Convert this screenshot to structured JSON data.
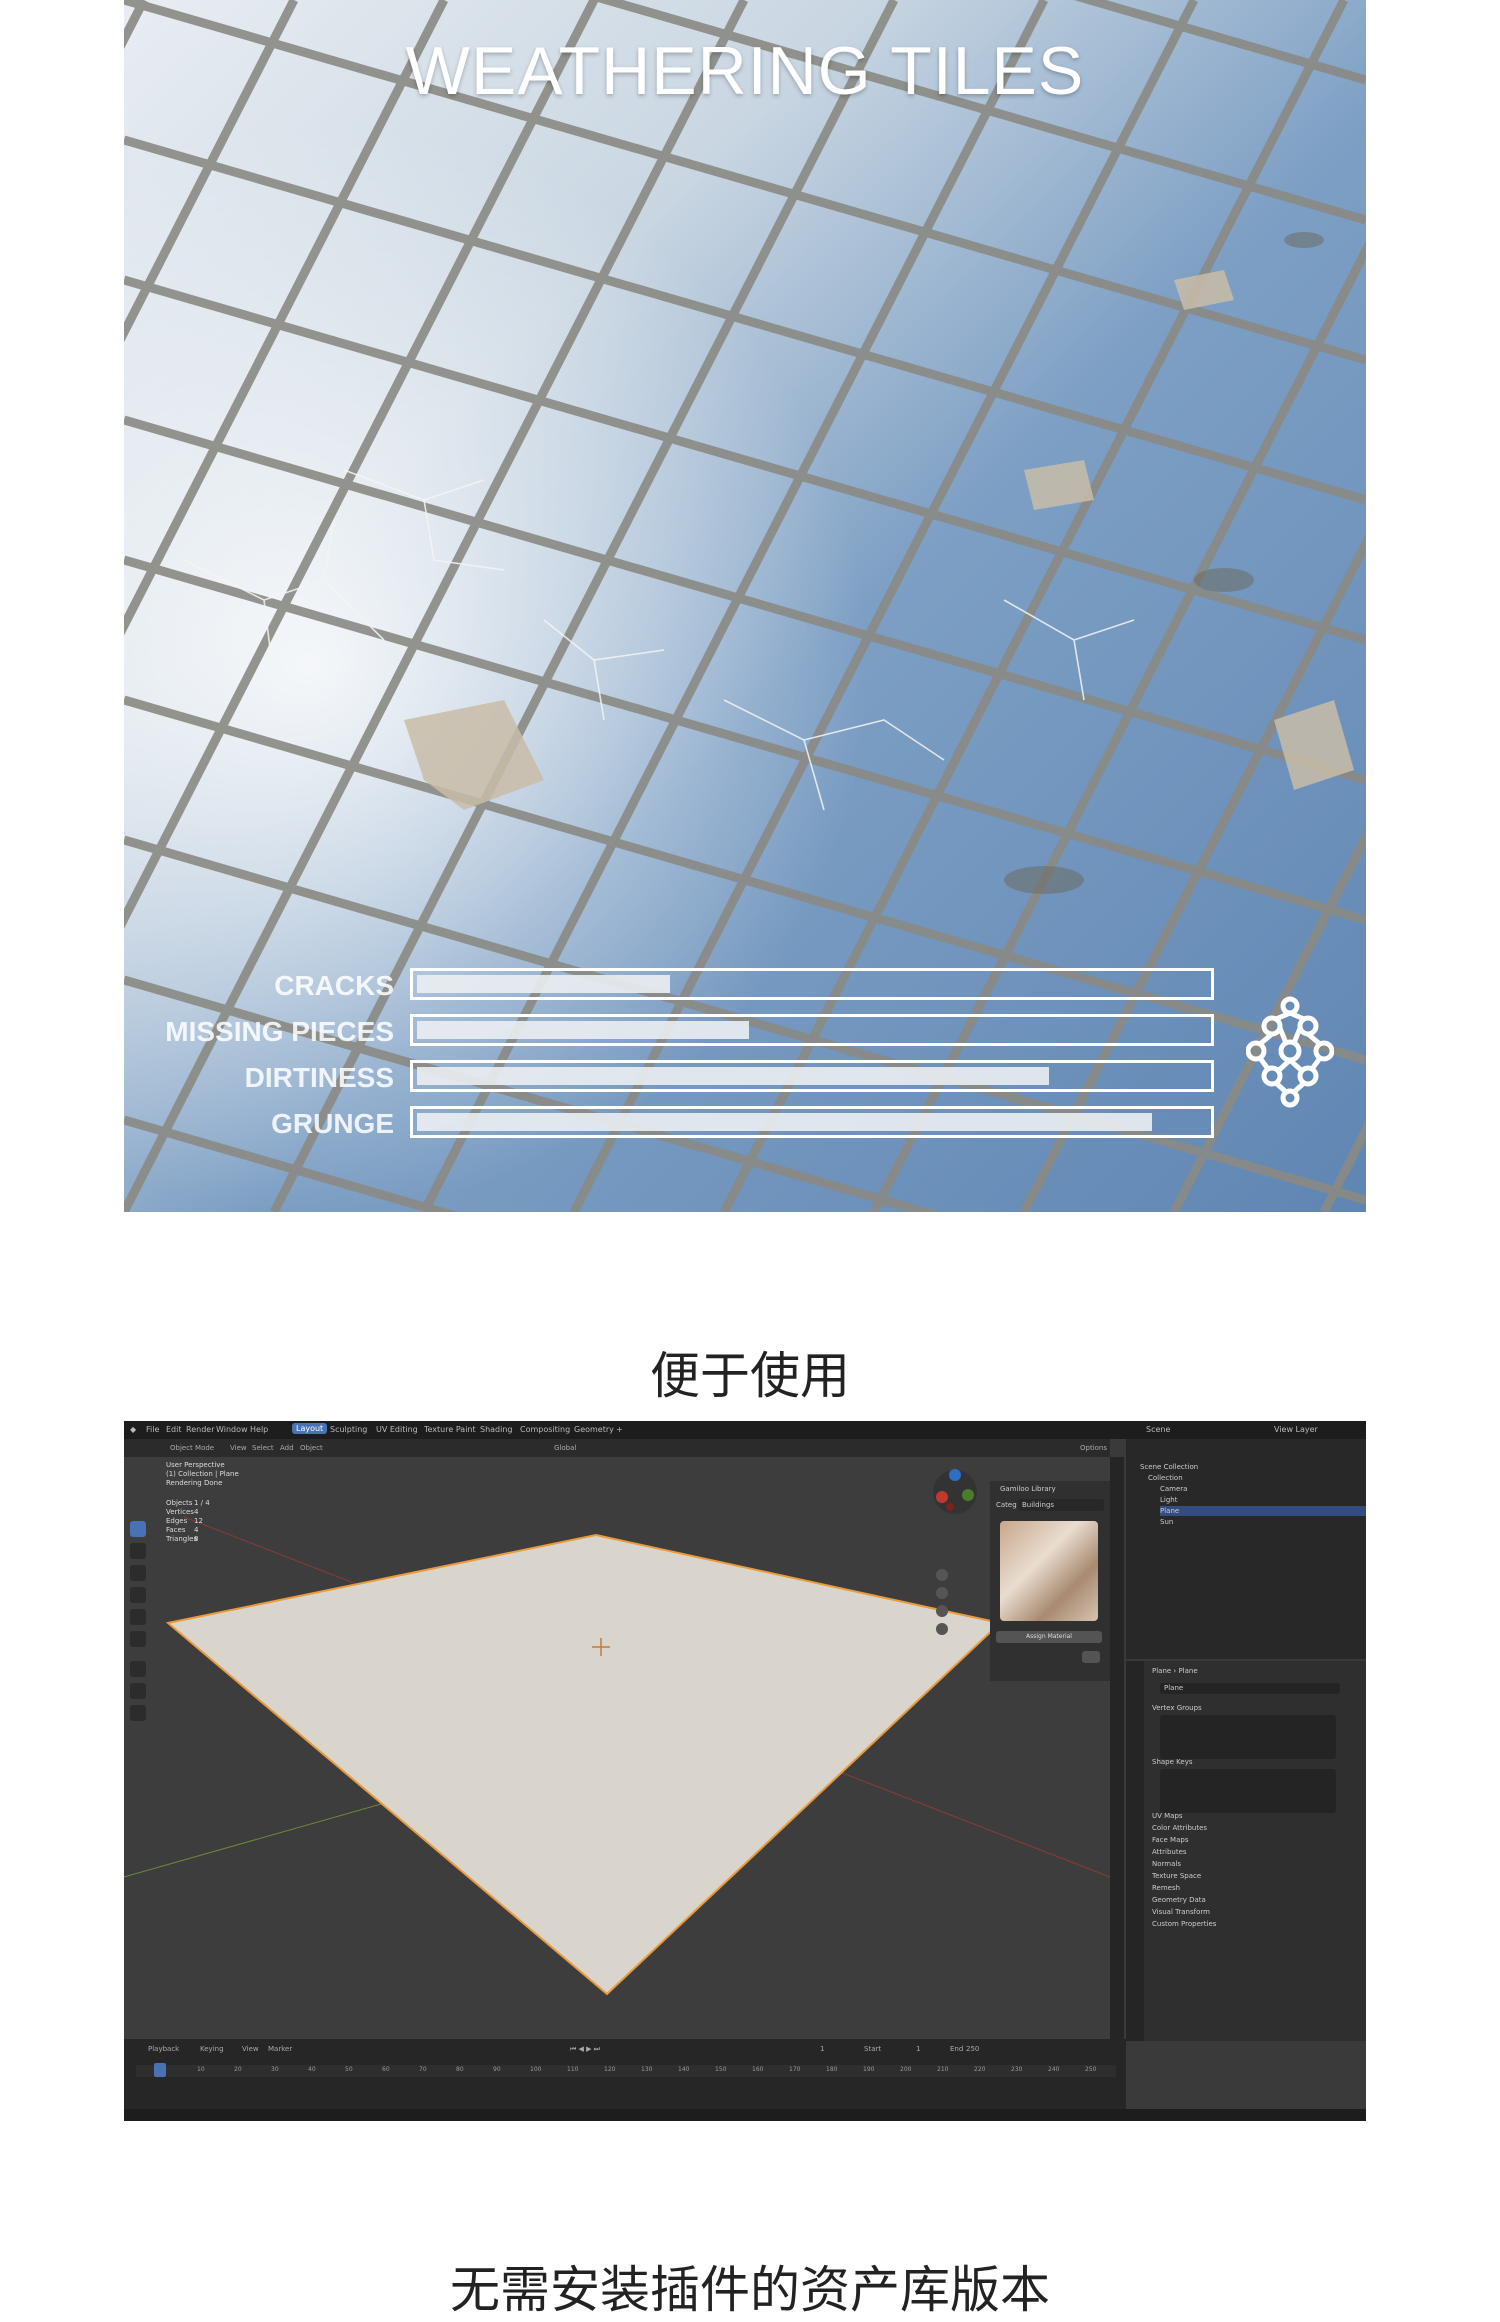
{
  "hero": {
    "title": "WEATHERING TILES",
    "sliders": [
      {
        "label": "CRACKS",
        "level": 0.32
      },
      {
        "label": "MISSING PIECES",
        "level": 0.42
      },
      {
        "label": "DIRTINESS",
        "level": 0.8
      },
      {
        "label": "GRUNGE",
        "level": 0.93
      }
    ],
    "logo_icon": "molecule-logo-icon"
  },
  "captions": {
    "first": "便于使用",
    "second": "无需安装插件的资产库版本"
  },
  "blender": {
    "menu": [
      "File",
      "Edit",
      "Render",
      "Window",
      "Help"
    ],
    "workspaces": [
      "Layout",
      "Sculpting",
      "UV Editing",
      "Texture Paint",
      "Shading",
      "Compositing",
      "Geometry",
      "+"
    ],
    "active_workspace": "Layout",
    "scene": "Scene",
    "view_layer": "View Layer",
    "viewport_header": {
      "mode": "Object Mode",
      "menus": [
        "View",
        "Select",
        "Add",
        "Object"
      ],
      "transform": "Global",
      "options": "Options"
    },
    "viewport_info": [
      "User Perspective",
      "(1) Collection | Plane",
      "Rendering Done"
    ],
    "stats": [
      {
        "label": "Objects",
        "value": "1 / 4"
      },
      {
        "label": "Vertices",
        "value": "4"
      },
      {
        "label": "Edges",
        "value": "12"
      },
      {
        "label": "Faces",
        "value": "4"
      },
      {
        "label": "Triangles",
        "value": "8"
      }
    ],
    "material_panel": {
      "title": "Gamiloo Library",
      "category_label": "Categ",
      "category_value": "Buildings",
      "button": "Assign Material"
    },
    "outliner": {
      "root": "Scene Collection",
      "items": [
        {
          "name": "Collection",
          "selected": false
        },
        {
          "name": "Camera",
          "selected": false
        },
        {
          "name": "Light",
          "selected": false
        },
        {
          "name": "Plane",
          "selected": true
        },
        {
          "name": "Sun",
          "selected": false
        }
      ]
    },
    "properties": {
      "object_path": [
        "Plane",
        "Plane"
      ],
      "data_name": "Plane",
      "sections": [
        "Vertex Groups",
        "Shape Keys",
        "UV Maps",
        "Color Attributes",
        "Face Maps",
        "Attributes",
        "Normals",
        "Texture Space",
        "Remesh",
        "Geometry Data",
        "Visual Transform",
        "Custom Properties"
      ]
    },
    "timeline": {
      "menus": [
        "Playback",
        "Keying",
        "View",
        "Marker"
      ],
      "current_frame": "1",
      "start_label": "Start",
      "start": "1",
      "end_label": "End",
      "end": "250",
      "ruler": [
        "0",
        "10",
        "20",
        "30",
        "40",
        "50",
        "60",
        "70",
        "80",
        "90",
        "100",
        "110",
        "120",
        "130",
        "140",
        "150",
        "160",
        "170",
        "180",
        "190",
        "200",
        "210",
        "220",
        "230",
        "240",
        "250"
      ]
    },
    "colors": {
      "accent": "#4772b3",
      "plane": "#d9d5cc",
      "selection_outline": "#e89a3c"
    }
  }
}
